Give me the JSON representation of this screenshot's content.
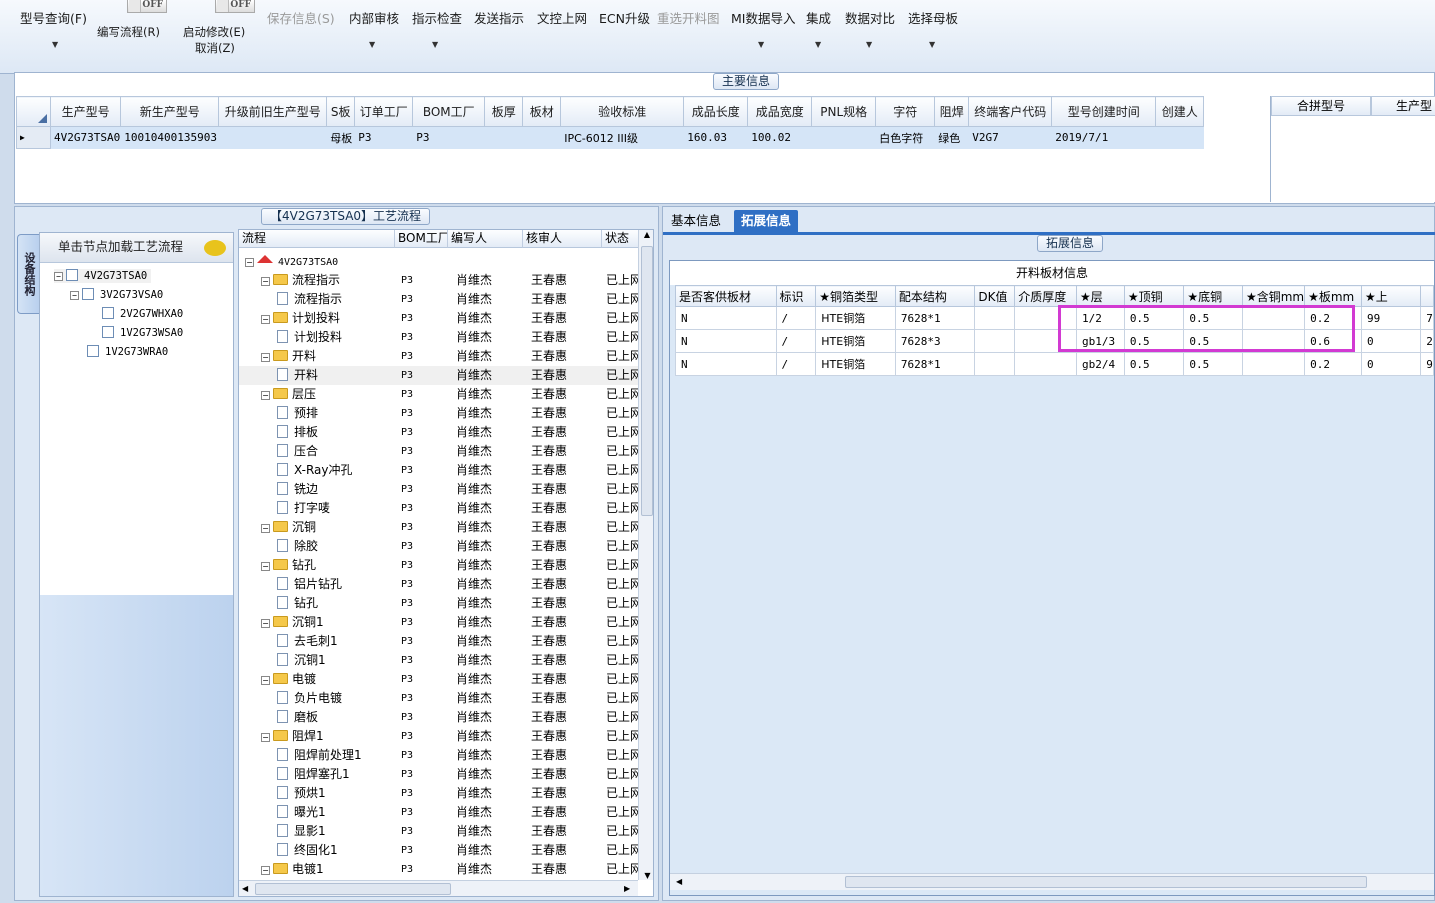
{
  "ribbon": {
    "model_query": "型号查询(F)",
    "toggle1": "OFF",
    "edit_flow": "编写流程(R)",
    "toggle2": "OFF",
    "start_edit": "启动修改(E)",
    "cancel": "取消(Z)",
    "save_info": "保存信息(S)",
    "internal_review": "内部审核",
    "instruction_check": "指示检查",
    "send_instruction": "发送指示",
    "doc_upload": "文控上网",
    "ecn_upgrade": "ECN升级",
    "reselect_cut": "重选开料图",
    "mi_import": "MI数据导入",
    "integrate": "集成",
    "data_compare": "数据对比",
    "select_master": "选择母板"
  },
  "main_info": {
    "title": "主要信息",
    "columns": [
      "生产型号",
      "新生产型号",
      "升级前旧生产型号",
      "S板",
      "订单工厂",
      "BOM工厂",
      "板厚",
      "板材",
      "验收标准",
      "成品长度",
      "成品宽度",
      "PNL规格",
      "字符",
      "阻焊",
      "终端客户代码",
      "型号创建时间",
      "创建人"
    ],
    "row": [
      "4V2G73TSA0",
      "10010400135903",
      "",
      "母板",
      "P3",
      "P3",
      "",
      "",
      "IPC-6012 III级",
      "160.03",
      "100.02",
      "",
      "白色字符",
      "绿色",
      "V2G7",
      "2019/7/1",
      ""
    ],
    "side_columns": [
      "合拼型号",
      "生产型"
    ]
  },
  "flow_panel": {
    "title": "【4V2G73TSA0】工艺流程",
    "vtab": "设备结构",
    "tree_header": "单击节点加载工艺流程",
    "struct_nodes": [
      "4V2G73TSA0",
      "3V2G73VSA0",
      "2V2G7WHXA0",
      "1V2G73WSA0",
      "1V2G73WRA0"
    ],
    "columns": [
      "流程",
      "BOM工厂",
      "编写人",
      "核审人",
      "状态"
    ],
    "root": "4V2G73TSA0",
    "rows": [
      {
        "name": "流程指示",
        "type": "folder",
        "bom": "P3",
        "writer": "肖维杰",
        "reviewer": "王春惠",
        "status": "已上网"
      },
      {
        "name": "流程指示",
        "type": "doc",
        "bom": "P3",
        "writer": "肖维杰",
        "reviewer": "王春惠",
        "status": "已上网"
      },
      {
        "name": "计划投料",
        "type": "folder",
        "bom": "P3",
        "writer": "肖维杰",
        "reviewer": "王春惠",
        "status": "已上网"
      },
      {
        "name": "计划投料",
        "type": "doc",
        "bom": "P3",
        "writer": "肖维杰",
        "reviewer": "王春惠",
        "status": "已上网"
      },
      {
        "name": "开料",
        "type": "folder",
        "bom": "P3",
        "writer": "肖维杰",
        "reviewer": "王春惠",
        "status": "已上网"
      },
      {
        "name": "开料",
        "type": "doc",
        "bom": "P3",
        "writer": "肖维杰",
        "reviewer": "王春惠",
        "status": "已上网"
      },
      {
        "name": "层压",
        "type": "folder",
        "bom": "P3",
        "writer": "肖维杰",
        "reviewer": "王春惠",
        "status": "已上网"
      },
      {
        "name": "预排",
        "type": "doc",
        "bom": "P3",
        "writer": "肖维杰",
        "reviewer": "王春惠",
        "status": "已上网"
      },
      {
        "name": "排板",
        "type": "doc",
        "bom": "P3",
        "writer": "肖维杰",
        "reviewer": "王春惠",
        "status": "已上网"
      },
      {
        "name": "压合",
        "type": "doc",
        "bom": "P3",
        "writer": "肖维杰",
        "reviewer": "王春惠",
        "status": "已上网"
      },
      {
        "name": "X-Ray冲孔",
        "type": "doc",
        "bom": "P3",
        "writer": "肖维杰",
        "reviewer": "王春惠",
        "status": "已上网"
      },
      {
        "name": "铣边",
        "type": "doc",
        "bom": "P3",
        "writer": "肖维杰",
        "reviewer": "王春惠",
        "status": "已上网"
      },
      {
        "name": "打字唛",
        "type": "doc",
        "bom": "P3",
        "writer": "肖维杰",
        "reviewer": "王春惠",
        "status": "已上网"
      },
      {
        "name": "沉铜",
        "type": "folder",
        "bom": "P3",
        "writer": "肖维杰",
        "reviewer": "王春惠",
        "status": "已上网"
      },
      {
        "name": "除胶",
        "type": "doc",
        "bom": "P3",
        "writer": "肖维杰",
        "reviewer": "王春惠",
        "status": "已上网"
      },
      {
        "name": "钻孔",
        "type": "folder",
        "bom": "P3",
        "writer": "肖维杰",
        "reviewer": "王春惠",
        "status": "已上网"
      },
      {
        "name": "铝片钻孔",
        "type": "doc",
        "bom": "P3",
        "writer": "肖维杰",
        "reviewer": "王春惠",
        "status": "已上网"
      },
      {
        "name": "钻孔",
        "type": "doc",
        "bom": "P3",
        "writer": "肖维杰",
        "reviewer": "王春惠",
        "status": "已上网"
      },
      {
        "name": "沉铜1",
        "type": "folder",
        "bom": "P3",
        "writer": "肖维杰",
        "reviewer": "王春惠",
        "status": "已上网"
      },
      {
        "name": "去毛刺1",
        "type": "doc",
        "bom": "P3",
        "writer": "肖维杰",
        "reviewer": "王春惠",
        "status": "已上网"
      },
      {
        "name": "沉铜1",
        "type": "doc",
        "bom": "P3",
        "writer": "肖维杰",
        "reviewer": "王春惠",
        "status": "已上网"
      },
      {
        "name": "电镀",
        "type": "folder",
        "bom": "P3",
        "writer": "肖维杰",
        "reviewer": "王春惠",
        "status": "已上网"
      },
      {
        "name": "负片电镀",
        "type": "doc",
        "bom": "P3",
        "writer": "肖维杰",
        "reviewer": "王春惠",
        "status": "已上网"
      },
      {
        "name": "磨板",
        "type": "doc",
        "bom": "P3",
        "writer": "肖维杰",
        "reviewer": "王春惠",
        "status": "已上网"
      },
      {
        "name": "阻焊1",
        "type": "folder",
        "bom": "P3",
        "writer": "肖维杰",
        "reviewer": "王春惠",
        "status": "已上网"
      },
      {
        "name": "阻焊前处理1",
        "type": "doc",
        "bom": "P3",
        "writer": "肖维杰",
        "reviewer": "王春惠",
        "status": "已上网"
      },
      {
        "name": "阻焊塞孔1",
        "type": "doc",
        "bom": "P3",
        "writer": "肖维杰",
        "reviewer": "王春惠",
        "status": "已上网"
      },
      {
        "name": "预烘1",
        "type": "doc",
        "bom": "P3",
        "writer": "肖维杰",
        "reviewer": "王春惠",
        "status": "已上网"
      },
      {
        "name": "曝光1",
        "type": "doc",
        "bom": "P3",
        "writer": "肖维杰",
        "reviewer": "王春惠",
        "status": "已上网"
      },
      {
        "name": "显影1",
        "type": "doc",
        "bom": "P3",
        "writer": "肖维杰",
        "reviewer": "王春惠",
        "status": "已上网"
      },
      {
        "name": "终固化1",
        "type": "doc",
        "bom": "P3",
        "writer": "肖维杰",
        "reviewer": "王春惠",
        "status": "已上网"
      },
      {
        "name": "电镀1",
        "type": "folder",
        "bom": "P3",
        "writer": "肖维杰",
        "reviewer": "王春惠",
        "status": "已上网"
      }
    ]
  },
  "detail_panel": {
    "tab_basic": "基本信息",
    "tab_ext": "拓展信息",
    "group_title": "拓展信息",
    "grid_title": "开料板材信息",
    "columns": [
      "是否客供板材",
      "标识",
      "★铜箔类型",
      "配本结构",
      "DK值",
      "介质厚度",
      "★层",
      "★顶铜",
      "★底铜",
      "★含铜mm",
      "★板mm",
      "★上",
      ""
    ],
    "rows": [
      [
        "N",
        "/",
        "HTE铜箔",
        "7628*1",
        "",
        "",
        "1/2",
        "0.5",
        "0.5",
        "",
        "0.2",
        "99",
        "7"
      ],
      [
        "N",
        "/",
        "HTE铜箔",
        "7628*3",
        "",
        "",
        "gb1/3",
        "0.5",
        "0.5",
        "",
        "0.6",
        "0",
        "2"
      ],
      [
        "N",
        "/",
        "HTE铜箔",
        "7628*1",
        "",
        "",
        "gb2/4",
        "0.5",
        "0.5",
        "",
        "0.2",
        "0",
        "9"
      ]
    ]
  },
  "colors": {
    "accent": "#2f6fc4",
    "highlight": "#d23ad2",
    "selected_row": "#d5e5f7"
  }
}
